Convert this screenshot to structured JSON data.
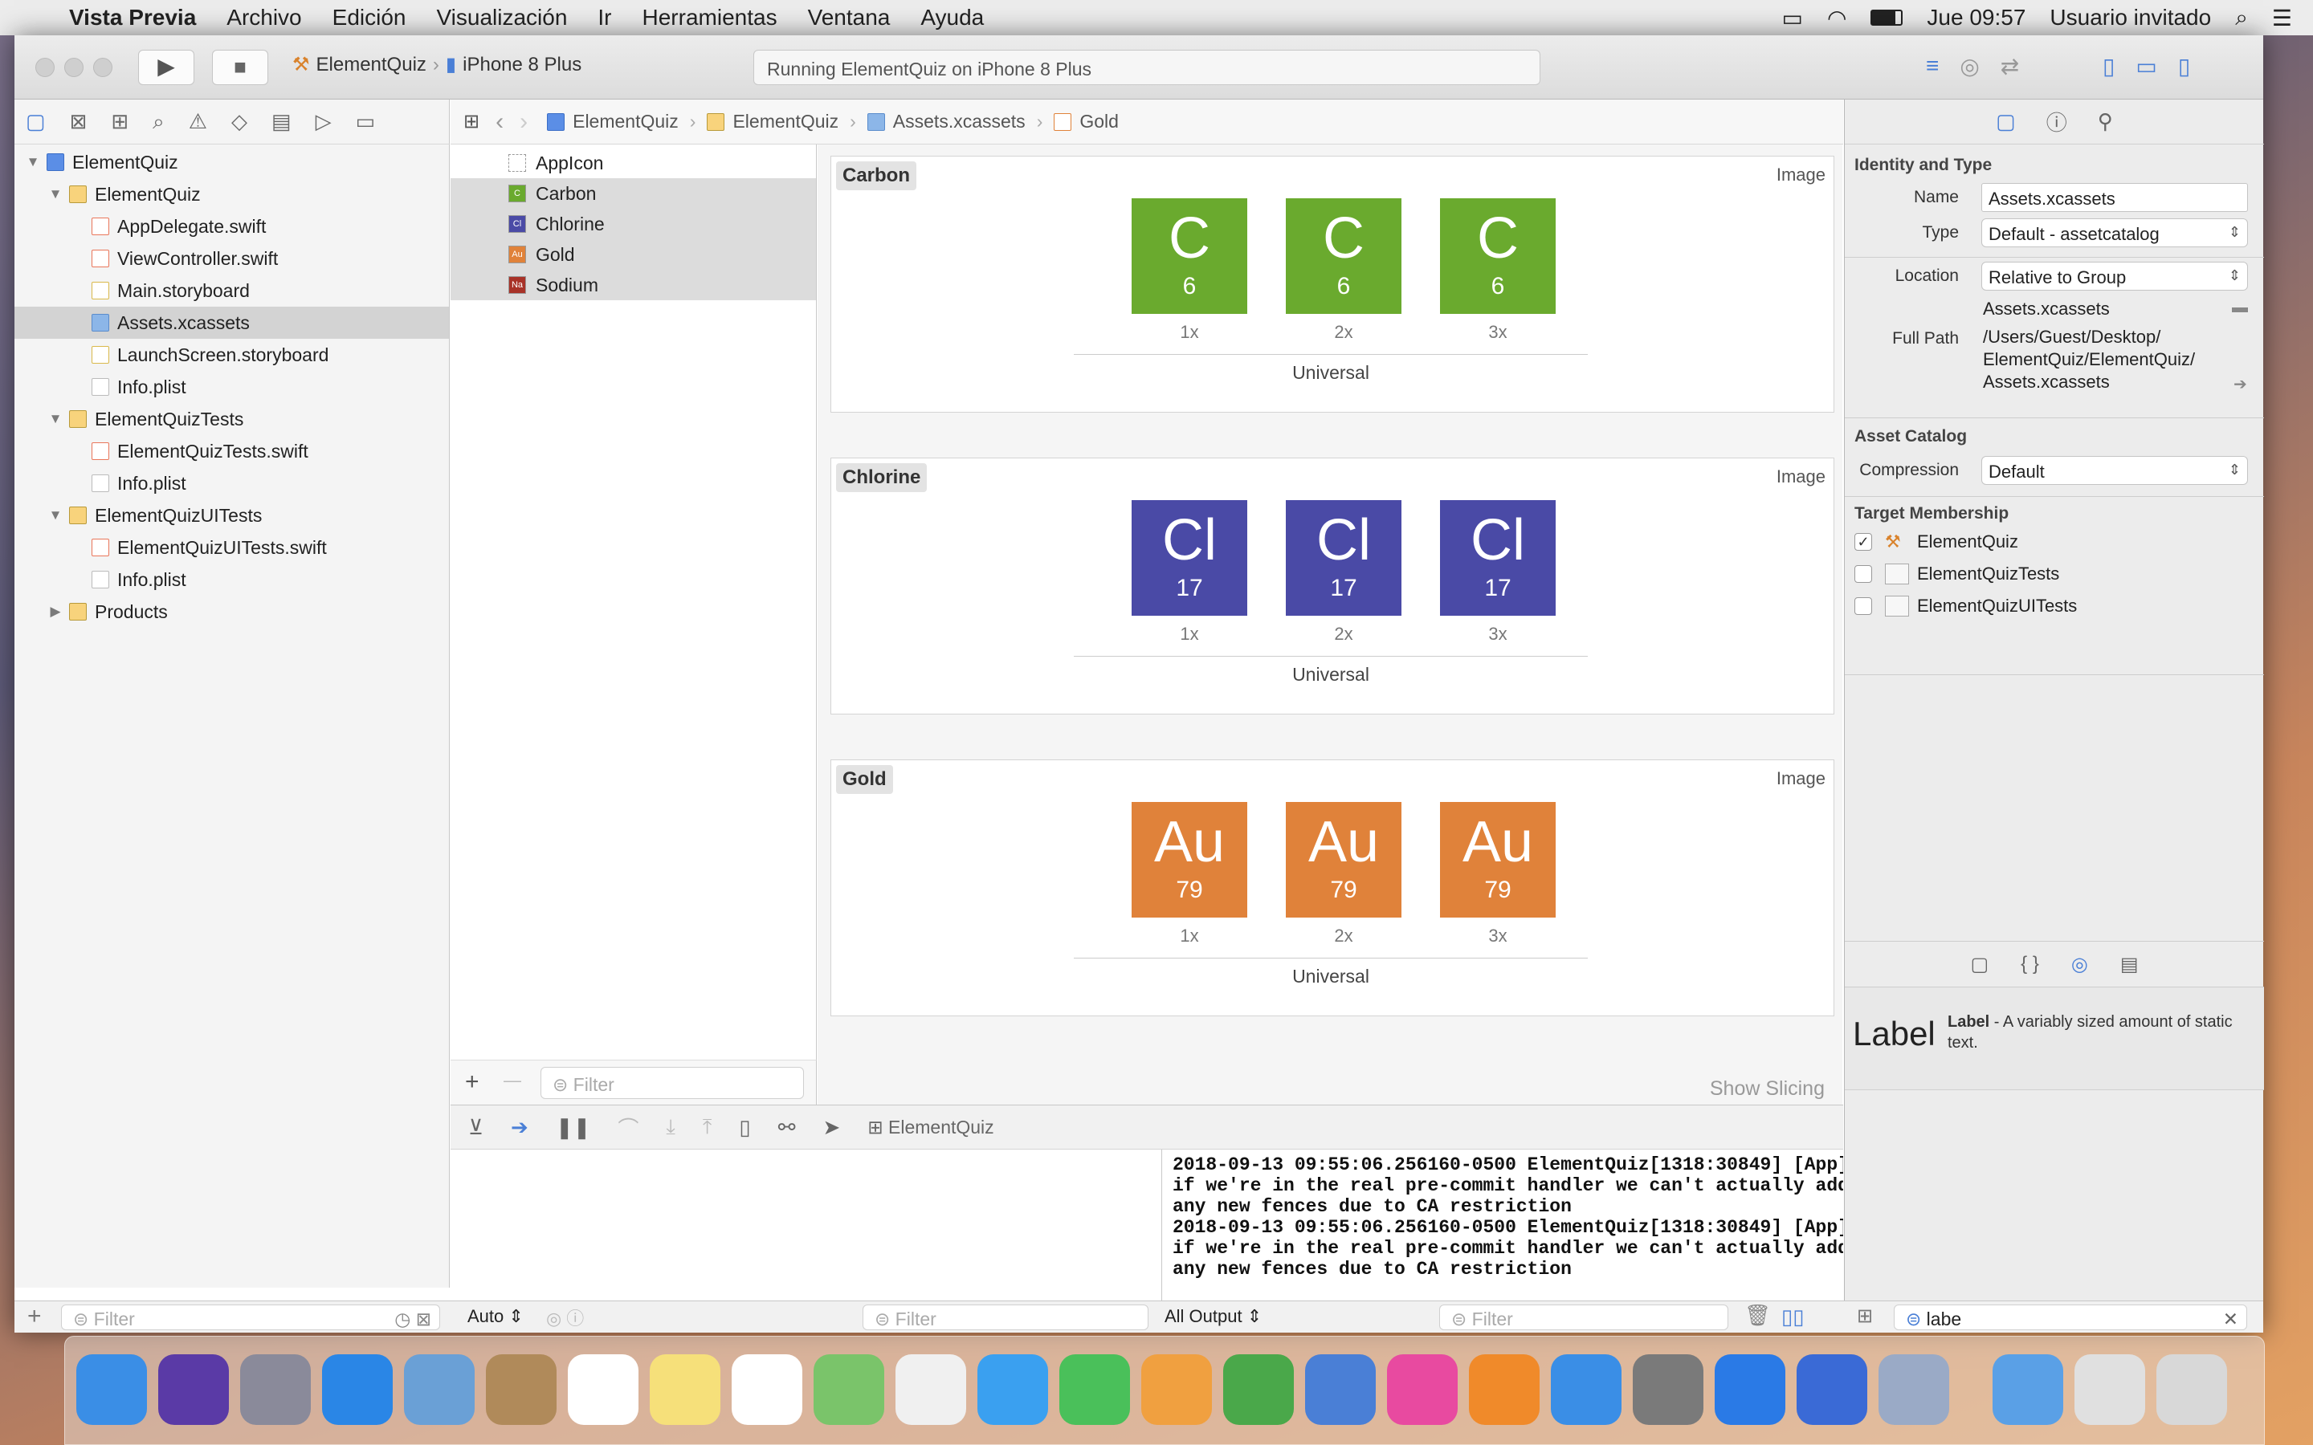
{
  "menubar": {
    "apple": "",
    "app": "Vista Previa",
    "items": [
      "Archivo",
      "Edición",
      "Visualización",
      "Ir",
      "Herramientas",
      "Ventana",
      "Ayuda"
    ],
    "clock": "Jue 09:57",
    "user": "Usuario invitado"
  },
  "toolbar": {
    "scheme": "ElementQuiz",
    "device": "iPhone 8 Plus",
    "status": "Running ElementQuiz on iPhone 8 Plus"
  },
  "navigator": {
    "items": [
      {
        "label": "ElementQuiz",
        "kind": "proj",
        "indent": 0,
        "tri": "▼"
      },
      {
        "label": "ElementQuiz",
        "kind": "folder",
        "indent": 1,
        "tri": "▼"
      },
      {
        "label": "AppDelegate.swift",
        "kind": "swift",
        "indent": 2,
        "tri": ""
      },
      {
        "label": "ViewController.swift",
        "kind": "swift",
        "indent": 2,
        "tri": ""
      },
      {
        "label": "Main.storyboard",
        "kind": "sb",
        "indent": 2,
        "tri": ""
      },
      {
        "label": "Assets.xcassets",
        "kind": "assets",
        "indent": 2,
        "tri": "",
        "selected": true
      },
      {
        "label": "LaunchScreen.storyboard",
        "kind": "sb",
        "indent": 2,
        "tri": ""
      },
      {
        "label": "Info.plist",
        "kind": "file",
        "indent": 2,
        "tri": ""
      },
      {
        "label": "ElementQuizTests",
        "kind": "folder",
        "indent": 1,
        "tri": "▼"
      },
      {
        "label": "ElementQuizTests.swift",
        "kind": "swift",
        "indent": 2,
        "tri": ""
      },
      {
        "label": "Info.plist",
        "kind": "file",
        "indent": 2,
        "tri": ""
      },
      {
        "label": "ElementQuizUITests",
        "kind": "folder",
        "indent": 1,
        "tri": "▼"
      },
      {
        "label": "ElementQuizUITests.swift",
        "kind": "swift",
        "indent": 2,
        "tri": ""
      },
      {
        "label": "Info.plist",
        "kind": "file",
        "indent": 2,
        "tri": ""
      },
      {
        "label": "Products",
        "kind": "folder",
        "indent": 1,
        "tri": "▶"
      }
    ],
    "filter_placeholder": "Filter"
  },
  "jumpbar": {
    "crumbs": [
      "ElementQuiz",
      "ElementQuiz",
      "Assets.xcassets",
      "Gold"
    ]
  },
  "assets": {
    "items": [
      {
        "label": "AppIcon",
        "badge": "",
        "color": "#ffffff",
        "selected": false
      },
      {
        "label": "Carbon",
        "badge": "C",
        "color": "#6aaa2e",
        "selected": true
      },
      {
        "label": "Chlorine",
        "badge": "Cl",
        "color": "#4a4aa6",
        "selected": true
      },
      {
        "label": "Gold",
        "badge": "Au",
        "color": "#e0823a",
        "selected": true
      },
      {
        "label": "Sodium",
        "badge": "Na",
        "color": "#a83228",
        "selected": true
      }
    ],
    "filter_placeholder": "Filter",
    "add": "+",
    "remove": "—"
  },
  "editor": {
    "cards": [
      {
        "title": "Carbon",
        "type": "Image",
        "symbol": "C",
        "number": "6",
        "color": "#6aaa2e"
      },
      {
        "title": "Chlorine",
        "type": "Image",
        "symbol": "Cl",
        "number": "17",
        "color": "#4a4aa6"
      },
      {
        "title": "Gold",
        "type": "Image",
        "symbol": "Au",
        "number": "79",
        "color": "#e0823a"
      }
    ],
    "scales": [
      "1x",
      "2x",
      "3x"
    ],
    "universal": "Universal",
    "show_slicing": "Show Slicing"
  },
  "debug": {
    "target": "ElementQuiz",
    "console": "2018-09-13 09:55:06.256160-0500 ElementQuiz[1318:30849] [App]\nif we're in the real pre-commit handler we can't actually add\nany new fences due to CA restriction\n2018-09-13 09:55:06.256160-0500 ElementQuiz[1318:30849] [App]\nif we're in the real pre-commit handler we can't actually add\nany new fences due to CA restriction",
    "auto": "Auto ⇕",
    "all_output": "All Output ⇕",
    "filter": "Filter"
  },
  "inspector": {
    "identity_title": "Identity and Type",
    "name_label": "Name",
    "name_value": "Assets.xcassets",
    "type_label": "Type",
    "type_value": "Default - assetcatalog",
    "location_label": "Location",
    "location_value": "Relative to Group",
    "location_file": "Assets.xcassets",
    "fullpath_label": "Full Path",
    "fullpath_value": "/Users/Guest/Desktop/\nElementQuiz/ElementQuiz/\nAssets.xcassets",
    "catalog_title": "Asset Catalog",
    "compression_label": "Compression",
    "compression_value": "Default",
    "membership_title": "Target Membership",
    "targets": [
      {
        "label": "ElementQuiz",
        "checked": "✓"
      },
      {
        "label": "ElementQuizTests",
        "checked": ""
      },
      {
        "label": "ElementQuizUITests",
        "checked": ""
      }
    ],
    "library_big": "Label",
    "library_name": "Label",
    "library_desc": " - A variably sized amount of static text.",
    "library_search": "labe"
  }
}
